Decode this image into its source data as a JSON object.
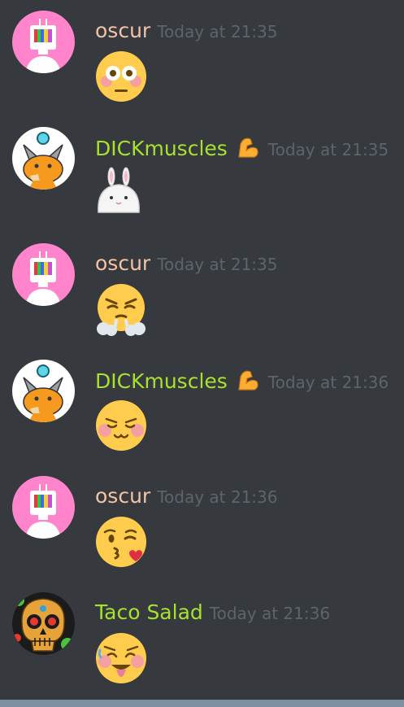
{
  "messages": [
    {
      "author": "oscur",
      "author_color": "#f4c3a6",
      "timestamp": "Today at 21:35",
      "avatar": "tv-head-robot-avatar",
      "badge": null,
      "emoji": "flushed-face-emoji"
    },
    {
      "author": "DICKmuscles",
      "author_color": "#a6e22e",
      "timestamp": "Today at 21:35",
      "avatar": "fox-avatar",
      "badge": "flexed-biceps-emoji",
      "emoji": "white-bunny-emoji"
    },
    {
      "author": "oscur",
      "author_color": "#f4c3a6",
      "timestamp": "Today at 21:35",
      "avatar": "tv-head-robot-avatar",
      "badge": null,
      "emoji": "triumph-face-emoji"
    },
    {
      "author": "DICKmuscles",
      "author_color": "#a6e22e",
      "timestamp": "Today at 21:36",
      "avatar": "fox-avatar",
      "badge": "flexed-biceps-emoji",
      "emoji": "blushing-smile-emoji"
    },
    {
      "author": "oscur",
      "author_color": "#f4c3a6",
      "timestamp": "Today at 21:36",
      "avatar": "tv-head-robot-avatar",
      "badge": null,
      "emoji": "kissing-face-emoji"
    },
    {
      "author": "Taco Salad",
      "author_color": "#a6e22e",
      "timestamp": "Today at 21:36",
      "avatar": "sugar-skull-avatar",
      "badge": null,
      "emoji": "ahegao-face-emoji"
    }
  ]
}
